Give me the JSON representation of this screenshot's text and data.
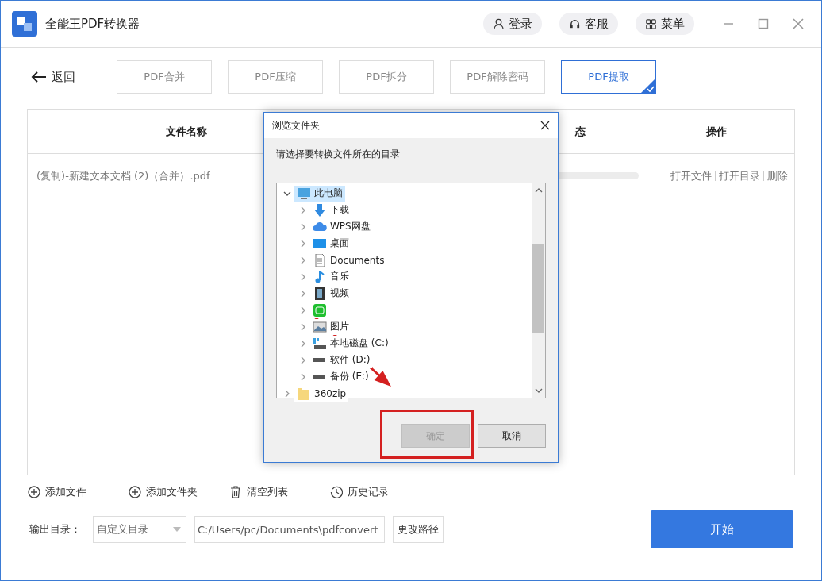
{
  "window": {
    "title": "全能王PDF转换器"
  },
  "header_buttons": [
    {
      "label": "登录",
      "kind": "user"
    },
    {
      "label": "客服",
      "kind": "headset"
    },
    {
      "label": "菜单",
      "kind": "grid"
    }
  ],
  "back": "返回",
  "tabs": [
    {
      "label": "PDF合并",
      "selected": false
    },
    {
      "label": "PDF压缩",
      "selected": false
    },
    {
      "label": "PDF拆分",
      "selected": false
    },
    {
      "label": "PDF解除密码",
      "selected": false
    },
    {
      "label": "PDF提取",
      "selected": true
    }
  ],
  "table": {
    "columns": [
      "文件名称",
      "态",
      "操作"
    ],
    "rows": [
      {
        "name": "(复制)-新建文本文档 (2)（合并）.pdf",
        "actions": [
          "打开文件",
          "打开目录",
          "删除"
        ]
      }
    ]
  },
  "dialog": {
    "title": "浏览文件夹",
    "prompt": "请选择要转换文件所在的目录",
    "tree": [
      {
        "label": "此电脑",
        "kind": "computer",
        "expanded": true,
        "selected": true,
        "children": [
          {
            "label": "下载",
            "kind": "download",
            "expanded": false,
            "selected": false
          },
          {
            "label": "WPS网盘",
            "kind": "cloud",
            "expanded": false,
            "selected": false
          },
          {
            "label": "桌面",
            "kind": "desktop",
            "expanded": false,
            "selected": false
          },
          {
            "label": "Documents",
            "kind": "document",
            "expanded": false,
            "selected": false
          },
          {
            "label": "音乐",
            "kind": "music",
            "expanded": false,
            "selected": false
          },
          {
            "label": "视频",
            "kind": "video",
            "expanded": false,
            "selected": false
          },
          {
            "kind": "app",
            "expanded": false,
            "selected": false
          },
          {
            "label": "图片",
            "kind": "pictures",
            "expanded": false,
            "selected": false
          },
          {
            "label": "本地磁盘 (C:)",
            "kind": "system-drive",
            "expanded": false,
            "selected": false
          },
          {
            "label": "软件 (D:)",
            "kind": "drive",
            "expanded": false,
            "selected": false
          },
          {
            "label": "备份 (E:)",
            "kind": "drive",
            "expanded": false,
            "selected": false
          }
        ]
      },
      {
        "label": "360zip",
        "kind": "folder",
        "expanded": false,
        "selected": false
      }
    ],
    "buttons": [
      {
        "label": "确定",
        "disabled": true
      },
      {
        "label": "取消",
        "disabled": false
      }
    ]
  },
  "toolbar": [
    {
      "label": "添加文件",
      "kind": "plus"
    },
    {
      "label": "添加文件夹",
      "kind": "plus"
    },
    {
      "label": "清空列表",
      "kind": "trash"
    },
    {
      "label": "历史记录",
      "kind": "history"
    }
  ],
  "output": {
    "label": "输出目录：",
    "mode": "自定义目录",
    "path": "C:/Users/pc/Documents\\pdfconvert",
    "change": "更改路径"
  },
  "start": "开始"
}
